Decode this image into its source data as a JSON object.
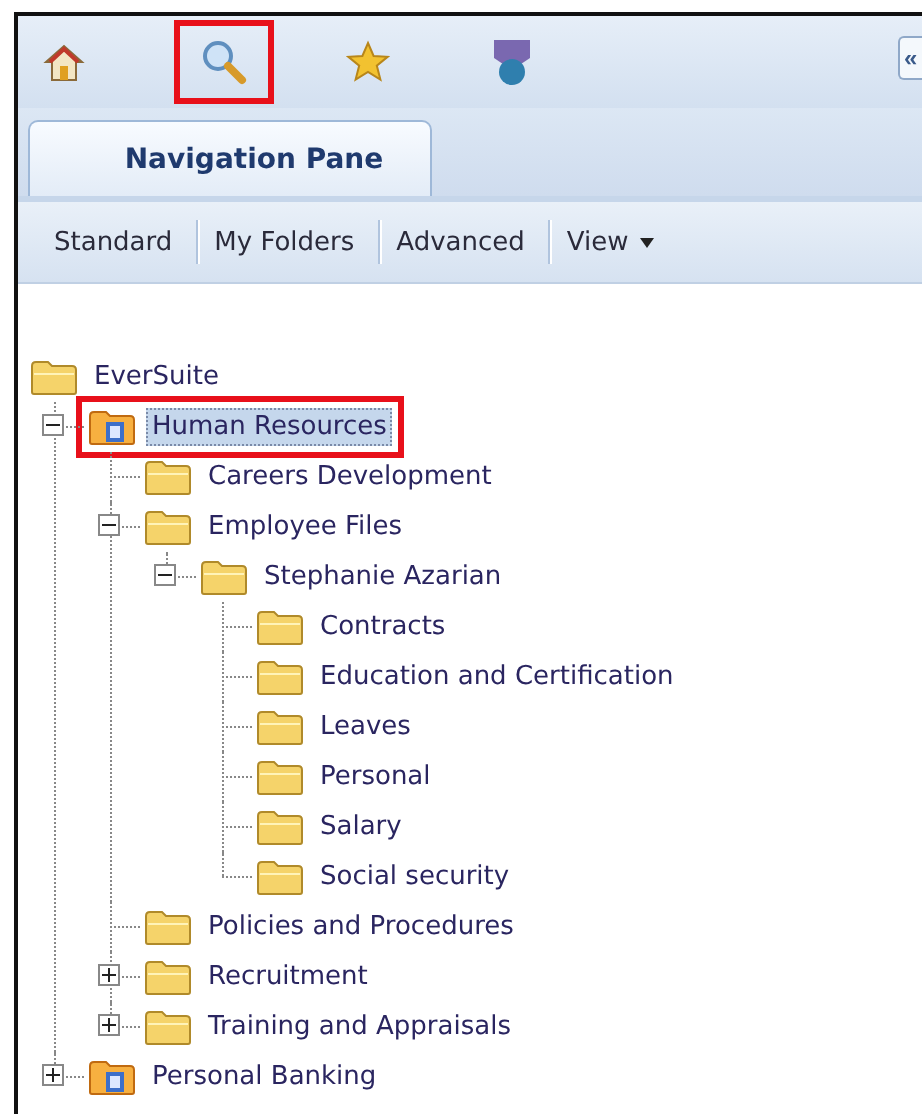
{
  "toolbar": {
    "icons": [
      {
        "kind": "home",
        "annotated": false
      },
      {
        "kind": "search",
        "annotated": true
      },
      {
        "kind": "star",
        "annotated": false
      },
      {
        "kind": "shield",
        "annotated": false
      }
    ],
    "collapse_button": "«"
  },
  "tabs": [
    {
      "label": "Navigation Pane",
      "selected": true
    }
  ],
  "menu": [
    {
      "label": "Standard",
      "dropdown": false
    },
    {
      "label": "My Folders",
      "dropdown": false
    },
    {
      "label": "Advanced",
      "dropdown": false
    },
    {
      "label": "View",
      "dropdown": true
    }
  ],
  "tree": {
    "label": "EverSuite",
    "kind": "folder",
    "selected": false,
    "annotated": false,
    "children": [
      {
        "label": "Human Resources",
        "kind": "cabinet",
        "selected": true,
        "annotated": true,
        "expanded": true,
        "children": [
          {
            "label": "Careers Development",
            "kind": "folder",
            "selected": false,
            "annotated": false
          },
          {
            "label": "Employee Files",
            "kind": "folder",
            "selected": false,
            "annotated": false,
            "expanded": true,
            "children": [
              {
                "label": "Stephanie Azarian",
                "kind": "folder",
                "selected": false,
                "annotated": false,
                "expanded": true,
                "children": [
                  {
                    "label": "Contracts",
                    "kind": "folder",
                    "selected": false,
                    "annotated": false
                  },
                  {
                    "label": "Education and Certification",
                    "kind": "folder",
                    "selected": false,
                    "annotated": false
                  },
                  {
                    "label": "Leaves",
                    "kind": "folder",
                    "selected": false,
                    "annotated": false
                  },
                  {
                    "label": "Personal",
                    "kind": "folder",
                    "selected": false,
                    "annotated": false
                  },
                  {
                    "label": "Salary",
                    "kind": "folder",
                    "selected": false,
                    "annotated": false
                  },
                  {
                    "label": "Social security",
                    "kind": "folder",
                    "selected": false,
                    "annotated": false
                  }
                ]
              }
            ]
          },
          {
            "label": "Policies and Procedures",
            "kind": "folder",
            "selected": false,
            "annotated": false
          },
          {
            "label": "Recruitment",
            "kind": "folder",
            "selected": false,
            "annotated": false,
            "expanded": false
          },
          {
            "label": "Training and Appraisals",
            "kind": "folder",
            "selected": false,
            "annotated": false,
            "expanded": false
          }
        ]
      },
      {
        "label": "Personal Banking",
        "kind": "cabinet",
        "selected": false,
        "annotated": false,
        "expanded": false
      }
    ]
  }
}
